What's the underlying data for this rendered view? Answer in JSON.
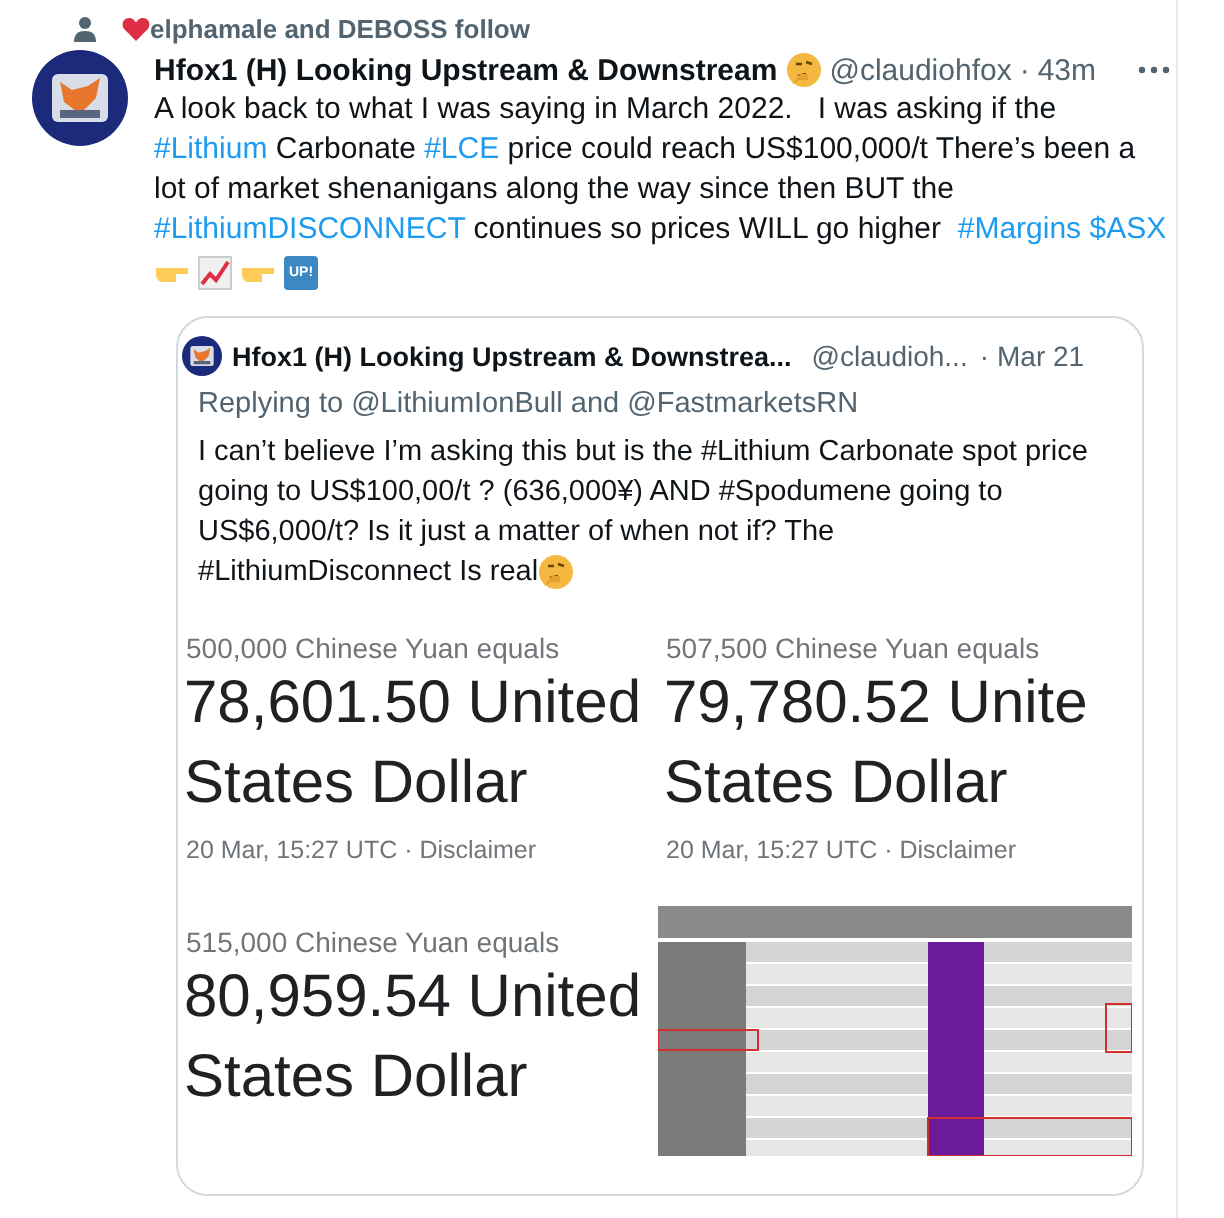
{
  "social_context": {
    "text": "elphamale and DEBOSS follow"
  },
  "tweet": {
    "author": "Hfox1 (H) Looking Upstream & Downstream",
    "handle": "@claudiohfox",
    "separator": "·",
    "time": "43m",
    "body": [
      {
        "text": "A look back to what I was saying in March 2022.   I was asking if the ",
        "link": false
      },
      {
        "text": "#Lithium",
        "link": true
      },
      {
        "text": " Carbonate ",
        "link": false
      },
      {
        "text": "#LCE",
        "link": true
      },
      {
        "text": " price could reach US$100,000/t There’s been a lot of market shenanigans along the way since then BUT the ",
        "link": false
      },
      {
        "text": "#LithiumDISCONNECT",
        "link": true
      },
      {
        "text": " continues so prices WILL go higher  ",
        "link": false
      },
      {
        "text": "#Margins",
        "link": true
      },
      {
        "text": "$ASX",
        "link": true,
        "space_before": true
      }
    ],
    "emojis": [
      {
        "kind": "point"
      },
      {
        "kind": "chart"
      },
      {
        "kind": "point"
      },
      {
        "kind": "up",
        "text": "UP!"
      }
    ]
  },
  "quote": {
    "author": "Hfox1 (H) Looking Upstream & Downstrea...",
    "handle": "@claudioh...",
    "separator": "·",
    "time": "Mar 21",
    "reply_to": "Replying to @LithiumIonBull and @FastmarketsRN",
    "body": "I can’t believe I’m asking this but is the #Lithium Carbonate spot price going to US$100,00/t ? (636,000¥) AND #Spodumene going to US$6,000/t? Is it just a matter of when not if?  The",
    "body_end": "#LithiumDisconnect Is real",
    "images": [
      {
        "kind": "converter",
        "from": "500,000 Chinese Yuan equals",
        "amount_lines": [
          "78,601.50 United",
          "States Dollar"
        ],
        "footer": "20 Mar, 15:27 UTC · Disclaimer"
      },
      {
        "kind": "converter",
        "from": "507,500 Chinese Yuan equals",
        "amount_lines": [
          "79,780.52 Unite",
          "States Dollar"
        ],
        "footer": "20 Mar, 15:27 UTC · Disclaimer"
      },
      {
        "kind": "converter",
        "from": "515,000 Chinese Yuan equals",
        "amount_lines": [
          "80,959.54 United",
          "States Dollar"
        ]
      },
      {
        "kind": "table"
      }
    ]
  }
}
